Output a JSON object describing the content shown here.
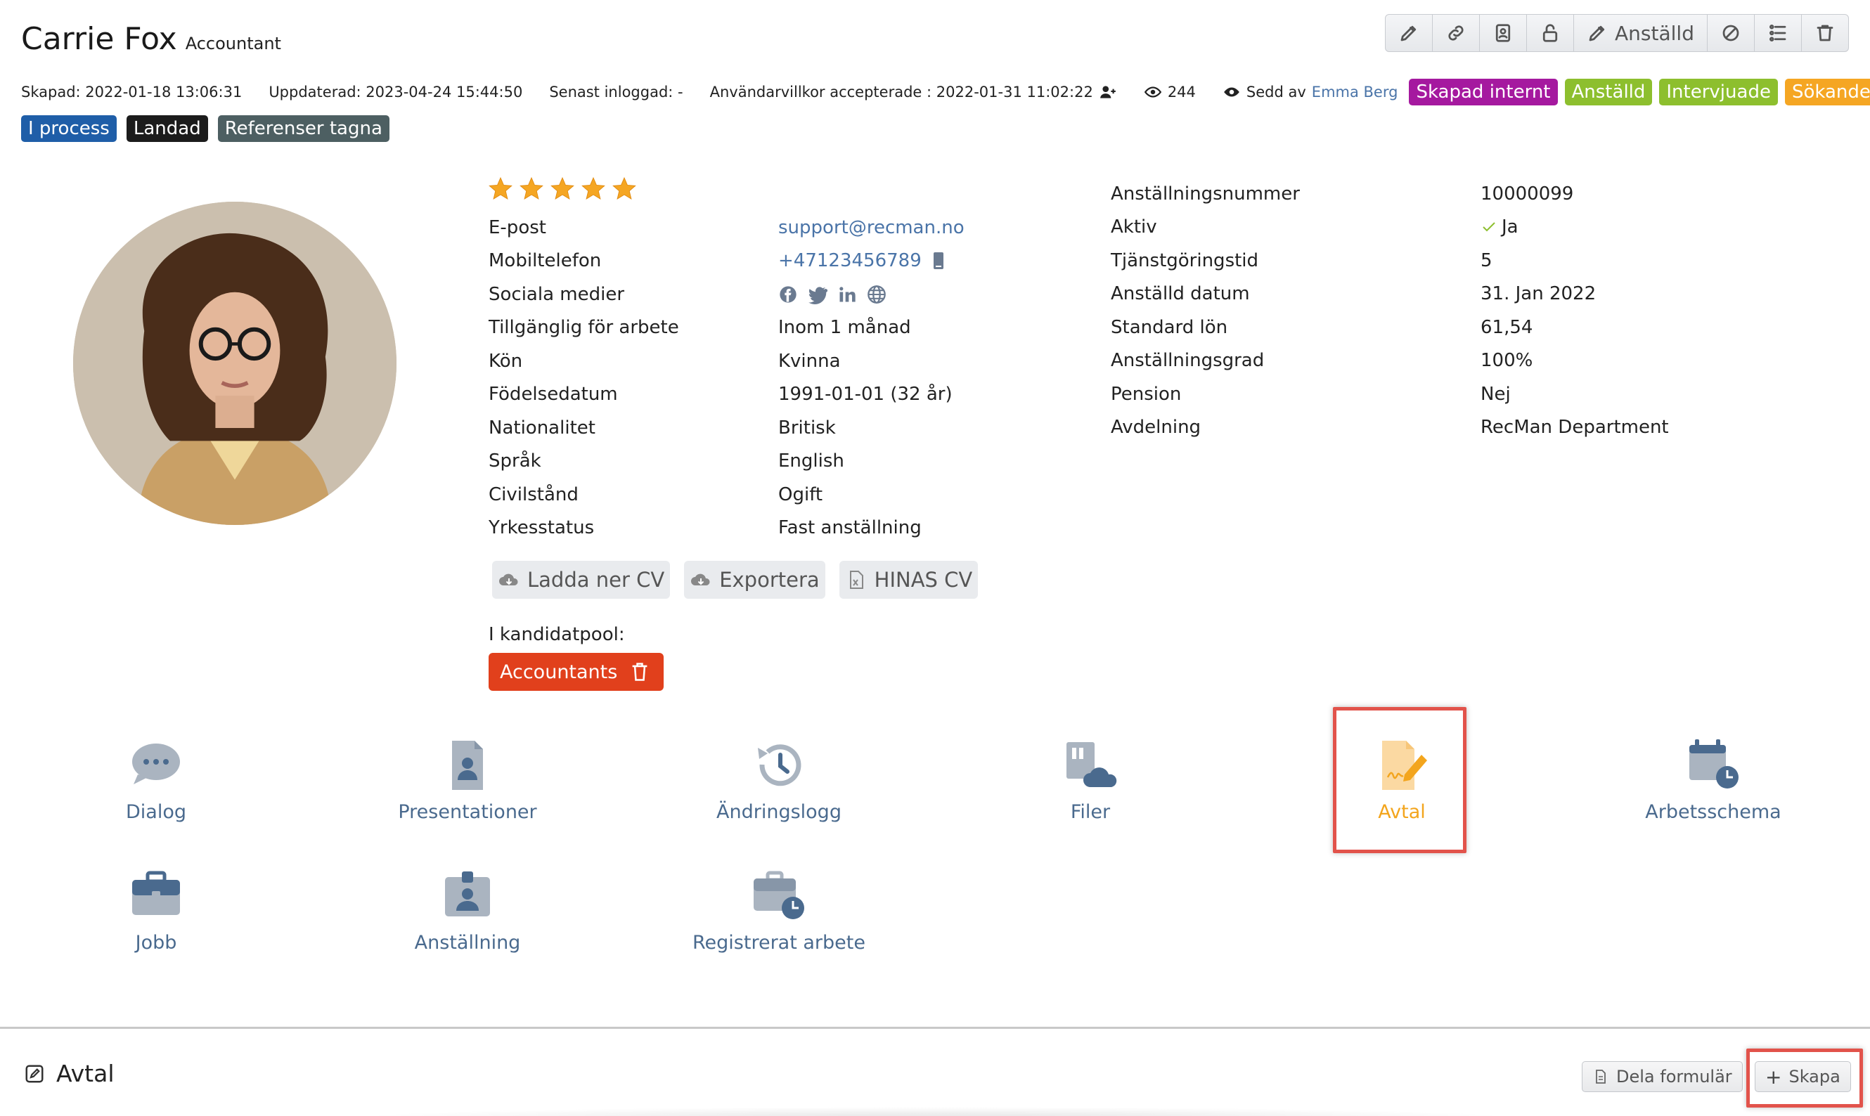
{
  "profile": {
    "name": "Carrie Fox",
    "role": "Accountant"
  },
  "toolbar": {
    "employed_label": "Anställd",
    "icons": [
      "pencil-icon",
      "link-icon",
      "contact-card-icon",
      "unlock-icon",
      "pencil-icon",
      "ban-icon",
      "list-settings-icon",
      "trash-icon"
    ]
  },
  "meta": {
    "created": "Skapad: 2022-01-18 13:06:31",
    "updated": "Uppdaterad: 2023-04-24 15:44:50",
    "last_login": "Senast inloggad:  -",
    "terms": "Användarvillkor accepterade : 2022-01-31 11:02:22",
    "views": "244",
    "seen_by_prefix": "Sedd av",
    "seen_by_name": "Emma Berg"
  },
  "status_tags": [
    {
      "label": "Skapad internt",
      "color": "#a5199f"
    },
    {
      "label": "Anställd",
      "color": "#8dbf2e"
    },
    {
      "label": "Intervjuade",
      "color": "#8dbf2e"
    },
    {
      "label": "Sökande",
      "color": "#f5a623"
    }
  ],
  "process_tags": [
    {
      "label": "I process",
      "color": "#1f5ea8"
    },
    {
      "label": "Landad",
      "color": "#1c1c1c"
    },
    {
      "label": "Referenser tagna",
      "color": "#4d5f62"
    }
  ],
  "rating": 5,
  "details": [
    {
      "label": "E-post",
      "value": "support@recman.no"
    },
    {
      "label": "Mobiltelefon",
      "value": "+47123456789"
    },
    {
      "label": "Sociala medier",
      "value": ""
    },
    {
      "label": "Tillgänglig för arbete",
      "value": "Inom 1 månad"
    },
    {
      "label": "Kön",
      "value": "Kvinna"
    },
    {
      "label": "Födelsedatum",
      "value": "1991-01-01 (32 år)"
    },
    {
      "label": "Nationalitet",
      "value": "Britisk"
    },
    {
      "label": "Språk",
      "value": "English"
    },
    {
      "label": "Civilstånd",
      "value": "Ogift"
    },
    {
      "label": "Yrkesstatus",
      "value": "Fast anställning"
    }
  ],
  "employment": [
    {
      "label": "Anställningsnummer",
      "value": "10000099"
    },
    {
      "label": "Aktiv",
      "value": "Ja"
    },
    {
      "label": "Tjänstgöringstid",
      "value": "5"
    },
    {
      "label": "Anställd datum",
      "value": "31. Jan 2022"
    },
    {
      "label": "Standard lön",
      "value": "61,54"
    },
    {
      "label": "Anställningsgrad",
      "value": "100%"
    },
    {
      "label": "Pension",
      "value": "Nej"
    },
    {
      "label": "Avdelning",
      "value": "RecMan Department"
    }
  ],
  "cv_actions": {
    "download": "Ladda ner CV",
    "export": "Exportera",
    "hinas": "HINAS CV"
  },
  "pool": {
    "label": "I kandidatpool:",
    "chip": "Accountants"
  },
  "modules": {
    "dialog": "Dialog",
    "presentations": "Presentationer",
    "changelog": "Ändringslogg",
    "files": "Filer",
    "agreements": "Avtal",
    "schedule": "Arbetsschema",
    "job": "Jobb",
    "employment": "Anställning",
    "registered_work": "Registrerat arbete"
  },
  "section": {
    "title": "Avtal",
    "share_form": "Dela formulär",
    "create": "Skapa",
    "create_prefix": "+"
  },
  "colors": {
    "accent_orange": "#f3a51d",
    "module_blue": "#4a6a8e",
    "highlight_red": "#e2534b",
    "link_blue": "#4a74a8",
    "pool_red": "#e1401c"
  }
}
